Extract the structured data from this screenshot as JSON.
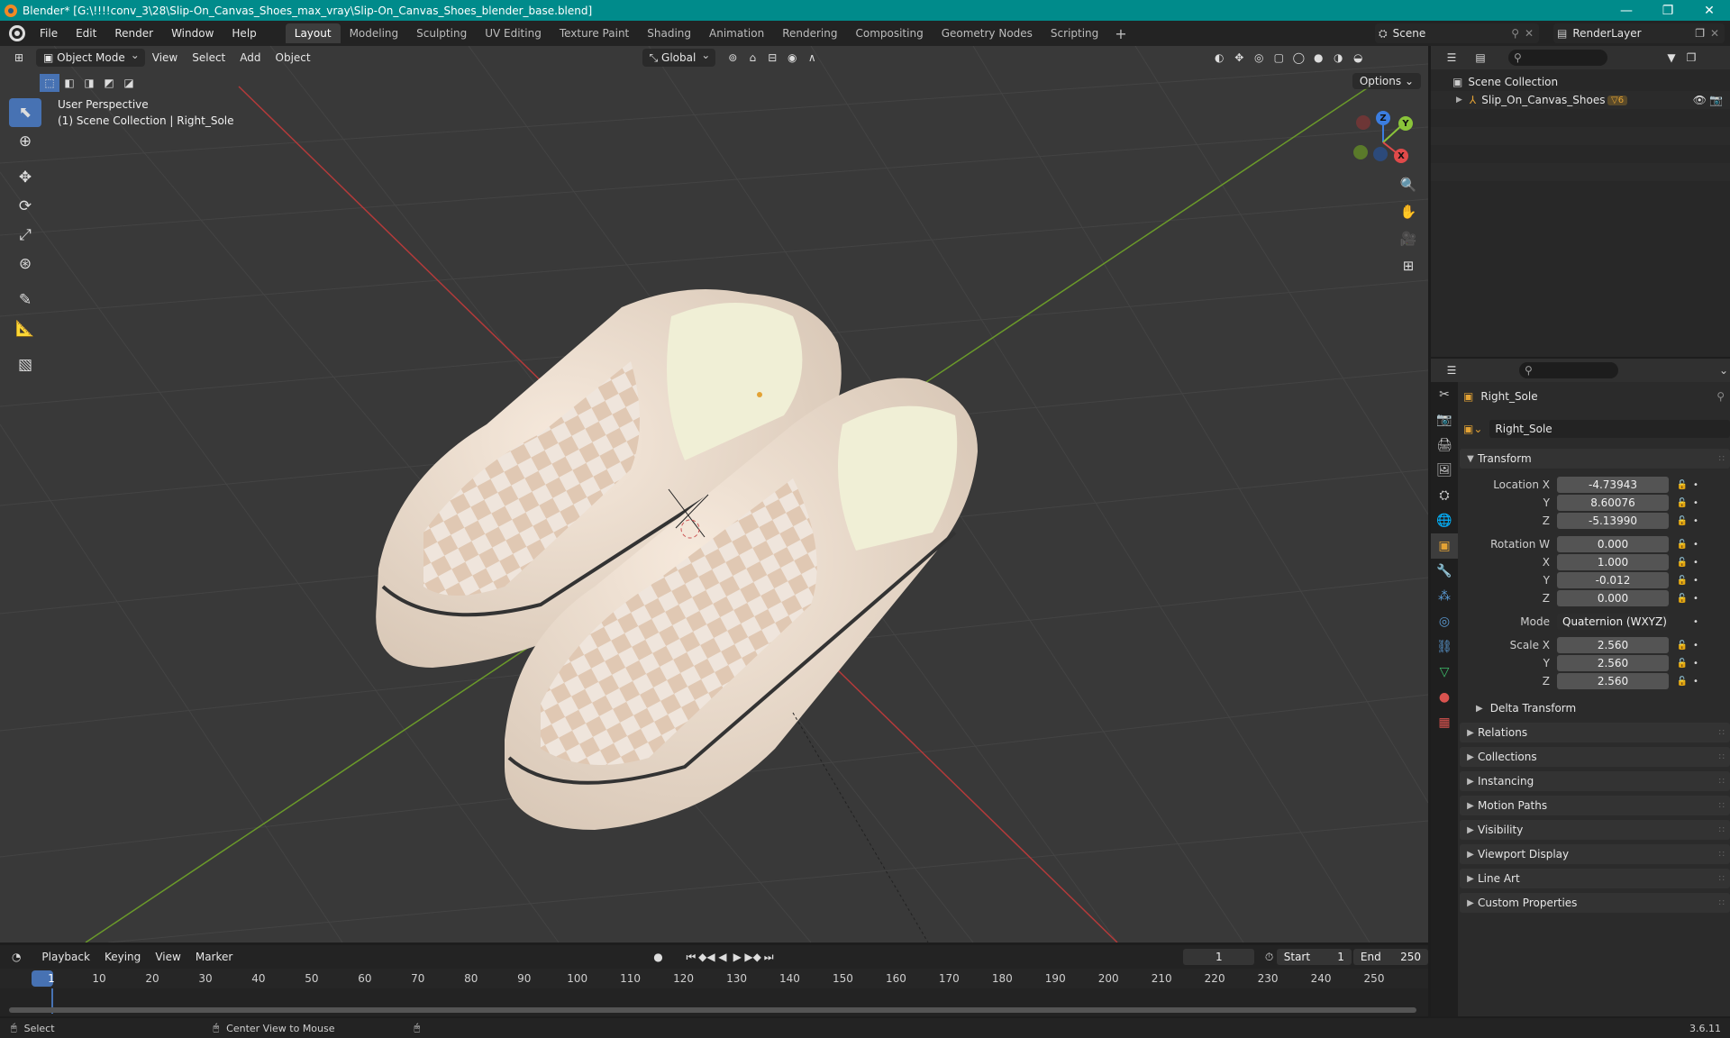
{
  "window": {
    "title": "Blender* [G:\\!!!!conv_3\\28\\Slip-On_Canvas_Shoes_max_vray\\Slip-On_Canvas_Shoes_blender_base.blend]",
    "minimize": "—",
    "maximize": "❐",
    "close": "✕"
  },
  "menu": [
    "File",
    "Edit",
    "Render",
    "Window",
    "Help"
  ],
  "workspaces": [
    "Layout",
    "Modeling",
    "Sculpting",
    "UV Editing",
    "Texture Paint",
    "Shading",
    "Animation",
    "Rendering",
    "Compositing",
    "Geometry Nodes",
    "Scripting"
  ],
  "active_workspace": "Layout",
  "scene": {
    "name": "Scene",
    "render_layer": "RenderLayer"
  },
  "viewport": {
    "mode": "Object Mode",
    "menus": [
      "View",
      "Select",
      "Add",
      "Object"
    ],
    "orientation": "Global",
    "options_label": "Options",
    "perspective_label": "User Perspective",
    "collection_label": "(1) Scene Collection | Right_Sole",
    "gizmo": {
      "x": "X",
      "y": "Y",
      "z": "Z"
    }
  },
  "outliner": {
    "root": "Scene Collection",
    "items": [
      {
        "name": "Slip_On_Canvas_Shoes",
        "badge": "6"
      }
    ]
  },
  "properties": {
    "object_name": "Right_Sole",
    "data_name": "Right_Sole",
    "transform_title": "Transform",
    "location": {
      "label": "Location X",
      "x": "-4.73943",
      "y": "8.60076",
      "z": "-5.13990"
    },
    "rotation": {
      "label": "Rotation W",
      "w": "0.000",
      "x": "1.000",
      "y": "-0.012",
      "z": "0.000"
    },
    "mode_label": "Mode",
    "mode_value": "Quaternion (WXYZ)",
    "scale": {
      "label": "Scale X",
      "x": "2.560",
      "y": "2.560",
      "z": "2.560"
    },
    "axis_labels": {
      "x": "X",
      "y": "Y",
      "z": "Z"
    },
    "delta_transform": "Delta Transform",
    "panels": [
      "Relations",
      "Collections",
      "Instancing",
      "Motion Paths",
      "Visibility",
      "Viewport Display",
      "Line Art",
      "Custom Properties"
    ]
  },
  "timeline": {
    "menus": [
      "Playback",
      "Keying",
      "View",
      "Marker"
    ],
    "current_frame": "1",
    "start_label": "Start",
    "start": "1",
    "end_label": "End",
    "end": "250",
    "ruler": [
      "1",
      "10",
      "20",
      "30",
      "40",
      "50",
      "60",
      "70",
      "80",
      "90",
      "100",
      "110",
      "120",
      "130",
      "140",
      "150",
      "160",
      "170",
      "180",
      "190",
      "200",
      "210",
      "220",
      "230",
      "240",
      "250"
    ]
  },
  "status": {
    "select": "Select",
    "center": "Center View to Mouse",
    "version": "3.6.11"
  }
}
